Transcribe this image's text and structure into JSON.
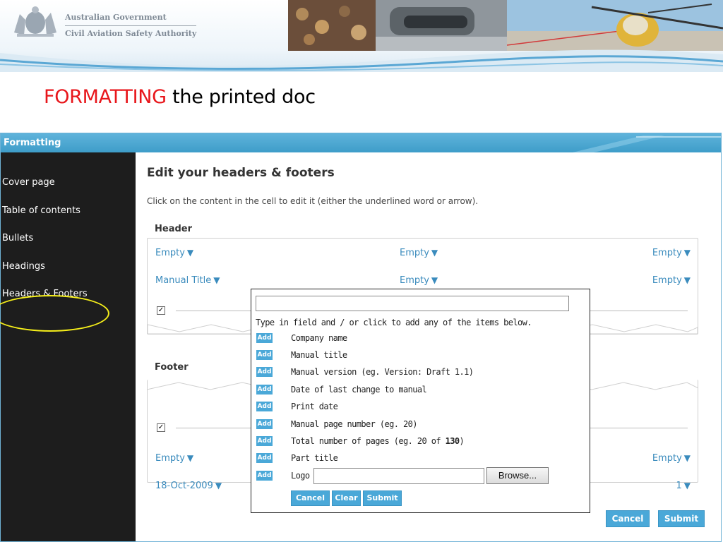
{
  "banner": {
    "gov_line1": "Australian Government",
    "gov_line2": "Civil Aviation Safety Authority",
    "logo_icon": "coat-of-arms-icon"
  },
  "slide_title": {
    "accent": "FORMATTING",
    "rest": " the printed doc",
    "accent_color": "#e8161b"
  },
  "app": {
    "title": "Formatting",
    "sidebar": {
      "items": [
        {
          "label": "Cover page"
        },
        {
          "label": "Table of contents"
        },
        {
          "label": "Bullets"
        },
        {
          "label": "Headings"
        },
        {
          "label": "Headers & Footers"
        }
      ],
      "highlight_color": "#f5ee1a"
    },
    "main": {
      "heading": "Edit your headers & footers",
      "instruction": "Click on the content in the cell to edit it (either the underlined word or arrow).",
      "header_label": "Header",
      "footer_label": "Footer",
      "arrow_glyph": "▼",
      "header_rows": [
        [
          "Empty",
          "Empty",
          "Empty"
        ],
        [
          "Manual Title",
          "Empty",
          "Empty"
        ]
      ],
      "footer_rows": [
        [
          "Empty",
          "Empty"
        ],
        [
          "18-Oct-2009",
          "1"
        ]
      ],
      "cancel_label": "Cancel",
      "submit_label": "Submit"
    },
    "popup": {
      "input_value": "",
      "hint": "Type in field and / or click to add any of the items below.",
      "add_label": "Add",
      "items": [
        "Company name",
        "Manual title",
        "Manual version (eg. Version: Draft 1.1)",
        "Date of last change to manual",
        "Print date",
        "Manual page number (eg. 20)"
      ],
      "total_pages_prefix": "Total number of pages (eg. 20 of ",
      "total_pages_bold": "130",
      "total_pages_suffix": ")",
      "part_title": "Part title",
      "logo_label": "Logo",
      "browse_label": "Browse...",
      "cancel_label": "Cancel",
      "clear_label": "Clear",
      "submit_label": "Submit"
    }
  },
  "colors": {
    "accent_blue": "#4aa8d8",
    "link_blue": "#3a8bbd",
    "sidebar_bg": "#1d1d1d"
  }
}
